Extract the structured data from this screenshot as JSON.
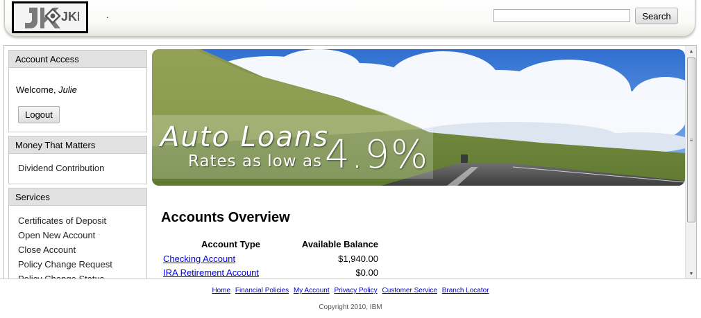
{
  "header": {
    "logo_text": "JKE",
    "separator_text": ".",
    "search": {
      "value": "",
      "placeholder": ""
    },
    "search_button_label": "Search"
  },
  "sidebar": {
    "account_access": {
      "title": "Account Access",
      "welcome_prefix": "Welcome, ",
      "user_name": "Julie",
      "logout_label": "Logout"
    },
    "money_that_matters": {
      "title": "Money That Matters",
      "items": [
        {
          "label": "Dividend Contribution"
        }
      ]
    },
    "services": {
      "title": "Services",
      "items": [
        {
          "label": "Certificates of Deposit"
        },
        {
          "label": "Open New Account"
        },
        {
          "label": "Close Account"
        },
        {
          "label": "Policy Change Request"
        },
        {
          "label": "Policy Change Status"
        }
      ]
    }
  },
  "banner": {
    "title": "Auto Loans",
    "subtitle": "Rates as low as",
    "rate": "4.9%"
  },
  "accounts_overview": {
    "title": "Accounts Overview",
    "columns": [
      "Account Type",
      "Available Balance"
    ],
    "rows": [
      {
        "type": "Checking Account",
        "balance": "$1,940.00"
      },
      {
        "type": "IRA Retirement Account",
        "balance": "$0.00"
      }
    ]
  },
  "footer": {
    "links": [
      {
        "label": "Home"
      },
      {
        "label": "Financial Policies"
      },
      {
        "label": "My Account"
      },
      {
        "label": "Privacy Policy"
      },
      {
        "label": "Customer Service"
      },
      {
        "label": "Branch Locator"
      }
    ],
    "copyright": "Copyright 2010, IBM"
  },
  "colors": {
    "link": "#0000ee",
    "panel_header_bg": "#e1e1e1",
    "sky": "#3f7fd6"
  },
  "icons": [
    "scroll-up-arrow-icon",
    "scroll-down-arrow-icon",
    "scroll-grip-icon"
  ]
}
